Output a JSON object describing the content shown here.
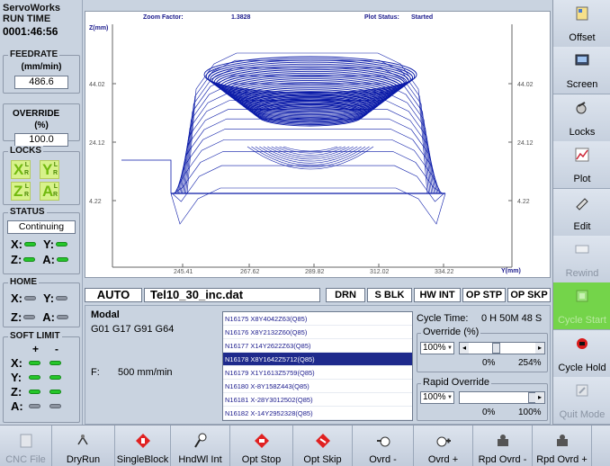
{
  "left": {
    "app_title": "ServoWorks",
    "run_time_label": "RUN TIME",
    "run_time": "0001:46:56",
    "feedrate_title": "FEEDRATE",
    "feedrate_unit": "(mm/min)",
    "feedrate_value": "486.6",
    "override_title": "OVERRIDE",
    "override_unit": "(%)",
    "override_value": "100.0",
    "locks_title": "LOCKS",
    "locks": [
      {
        "letter": "X",
        "sup": "L",
        "sub": "R"
      },
      {
        "letter": "Y",
        "sup": "L",
        "sub": "R"
      },
      {
        "letter": "Z",
        "sup": "L",
        "sub": "R"
      },
      {
        "letter": "A",
        "sup": "L",
        "sub": "R"
      }
    ],
    "status_title": "STATUS",
    "status_value": "Continuing",
    "status_axes": [
      "X:",
      "Y:",
      "Z:",
      "A:"
    ],
    "home_title": "HOME",
    "home_axes": [
      "X:",
      "Y:",
      "Z:",
      "A:"
    ],
    "softlimit_title": "SOFT LIMIT",
    "softlimit_plus": "+",
    "softlimit_minus": "-",
    "softlimit_axes": [
      "X:",
      "Y:",
      "Z:",
      "A:"
    ]
  },
  "plot": {
    "zoom_label": "Zoom Factor:",
    "zoom_value": "1.3828",
    "status_label": "Plot Status:",
    "status_value": "Started",
    "z_axis_label": "Z(mm)",
    "y_axis_label": "Y(mm)",
    "left_ticks": [
      "44.02",
      "24.12",
      "4.22"
    ],
    "right_ticks": [
      "44.02",
      "24.12",
      "4.22"
    ],
    "bottom_ticks": [
      "245.41",
      "267.62",
      "289.82",
      "312.02",
      "334.22"
    ]
  },
  "status_bar": {
    "mode": "AUTO",
    "filename": "Tel10_30_inc.dat",
    "drn": "DRN",
    "sblk": "S BLK",
    "hwint": "HW INT",
    "opstp": "OP STP",
    "opskp": "OP SKP"
  },
  "modal": {
    "label": "Modal",
    "codes": "G01 G17 G91 G64",
    "feed_label": "F:",
    "feed_value": "500 mm/min"
  },
  "program_lines": [
    "N16175 X8Y4042Z63(Q85)",
    "N16176 X8Y2132Z60(Q85)",
    "N16177 X14Y2622Z63(Q85)",
    "N16178 X8Y1642Z5712(Q85)",
    "N16179 X1Y1613Z5759(Q85)",
    "N16180 X-8Y158Z443(Q85)",
    "N16181 X-28Y3012502(Q85)",
    "N16182 X-14Y2952328(Q85)"
  ],
  "program_selected_index": 3,
  "cycle": {
    "label": "Cycle Time:",
    "value": "0  H 50M 48 S"
  },
  "override_panel": {
    "title": "Override (%)",
    "combo": "100%",
    "min": "0%",
    "max": "254%"
  },
  "rapid_panel": {
    "title": "Rapid Override",
    "combo": "100%",
    "min": "0%",
    "max": "100%"
  },
  "right_buttons": [
    {
      "label": "Offset",
      "icon": "offset-icon"
    },
    {
      "label": "Screen",
      "icon": "screen-icon"
    },
    {
      "label": "Locks",
      "icon": "locks-icon"
    },
    {
      "label": "Plot",
      "icon": "plot-icon"
    },
    {
      "label": "Edit",
      "icon": "edit-icon"
    },
    {
      "label": "Rewind",
      "icon": "rewind-icon"
    },
    {
      "label": "Cycle Start",
      "icon": "cycle-start-icon"
    },
    {
      "label": "Cycle Hold",
      "icon": "cycle-hold-icon"
    },
    {
      "label": "Quit Mode",
      "icon": "quit-mode-icon"
    }
  ],
  "bottom_buttons": [
    {
      "label": "CNC File",
      "icon": "cnc-file-icon"
    },
    {
      "label": "DryRun",
      "icon": "dryrun-icon"
    },
    {
      "label": "SingleBlock",
      "icon": "singleblock-icon"
    },
    {
      "label": "HndWl Int",
      "icon": "handwheel-icon"
    },
    {
      "label": "Opt Stop",
      "icon": "opt-stop-icon"
    },
    {
      "label": "Opt Skip",
      "icon": "opt-skip-icon"
    },
    {
      "label": "Ovrd -",
      "icon": "ovrd-minus-icon"
    },
    {
      "label": "Ovrd +",
      "icon": "ovrd-plus-icon"
    },
    {
      "label": "Rpd Ovrd -",
      "icon": "rpd-ovrd-minus-icon"
    },
    {
      "label": "Rpd Ovrd +",
      "icon": "rpd-ovrd-plus-icon"
    }
  ],
  "override_level_fraction": 0.39,
  "rapid_level_fraction": 1.0,
  "colors": {
    "toolpath": "#0a1aa8",
    "selection": "#1e2a8c",
    "cycle_start": "#74d44a",
    "lock_badge": "#d7f28a"
  }
}
